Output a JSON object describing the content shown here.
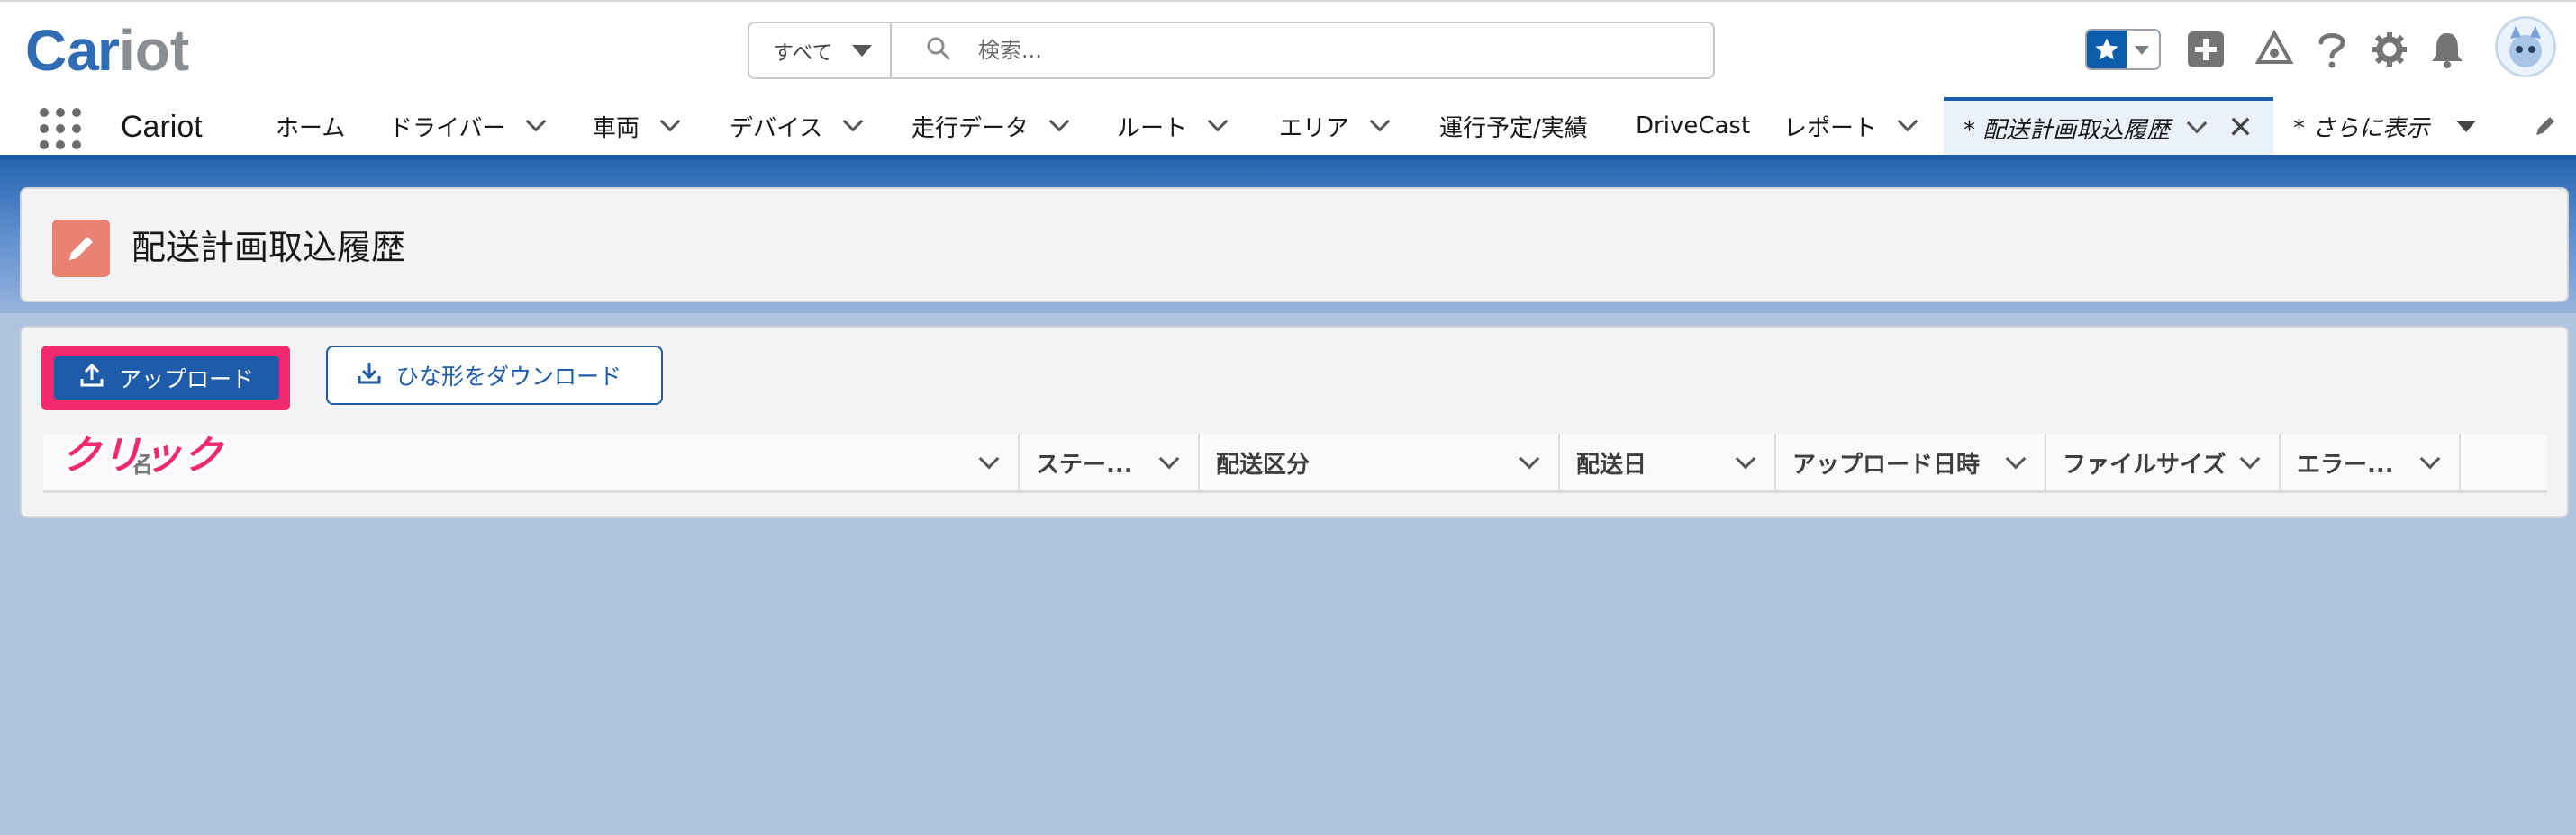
{
  "header": {
    "logo_text": "Cariot",
    "search": {
      "scope": "すべて",
      "placeholder": "検索..."
    }
  },
  "nav": {
    "app_name": "Cariot",
    "items": [
      {
        "label": "ホーム",
        "has_chevron": false
      },
      {
        "label": "ドライバー",
        "has_chevron": true
      },
      {
        "label": "車両",
        "has_chevron": true
      },
      {
        "label": "デバイス",
        "has_chevron": true
      },
      {
        "label": "走行データ",
        "has_chevron": true
      },
      {
        "label": "ルート",
        "has_chevron": true
      },
      {
        "label": "エリア",
        "has_chevron": true
      },
      {
        "label": "運行予定/実績",
        "has_chevron": false
      },
      {
        "label": "DriveCast",
        "has_chevron": false
      },
      {
        "label": "レポート",
        "has_chevron": true
      }
    ],
    "active_tab": {
      "label": "* 配送計画取込履歴"
    },
    "more": {
      "label": "* さらに表示"
    }
  },
  "page": {
    "title": "配送計画取込履歴"
  },
  "actions": {
    "upload_label": "アップロード",
    "download_template_label": "ひな形をダウンロード"
  },
  "annotation": {
    "text": "クリック",
    "color": "#f2296c"
  },
  "table": {
    "columns": [
      {
        "label": "名"
      },
      {
        "label": "ステー..."
      },
      {
        "label": "配送区分"
      },
      {
        "label": "配送日"
      },
      {
        "label": "アップロード日時"
      },
      {
        "label": "ファイルサイズ"
      },
      {
        "label": "エラー..."
      }
    ]
  },
  "colors": {
    "brand_blue": "#1e5ba8",
    "highlight_pink": "#f2296c",
    "page_icon": "#e88272",
    "background": "#b0c4df"
  }
}
